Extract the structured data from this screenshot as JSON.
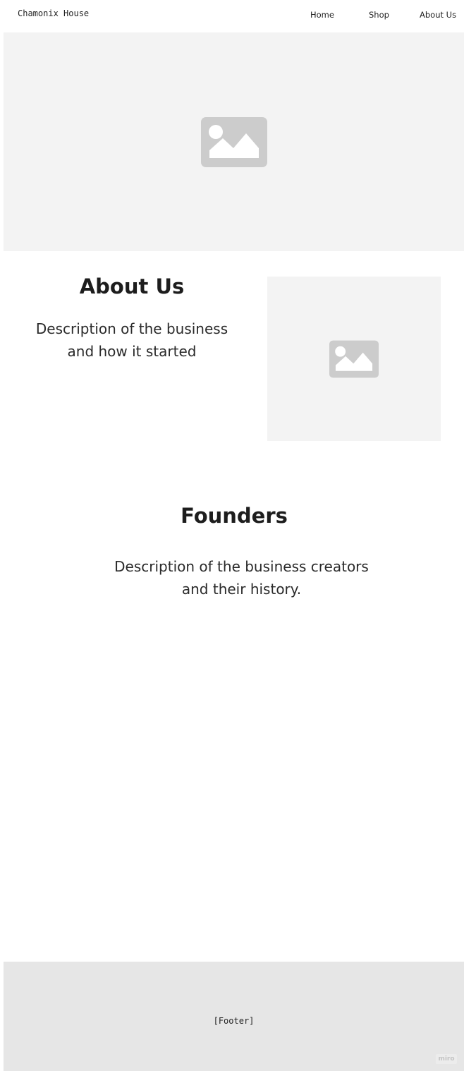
{
  "header": {
    "brand": "Chamonix House",
    "nav": {
      "home": "Home",
      "shop": "Shop",
      "about": "About Us"
    }
  },
  "hero": {
    "icon": "image-placeholder-icon"
  },
  "about": {
    "title": "About Us",
    "description_line1": "Description of the business",
    "description_line2": "and how it started",
    "icon": "image-placeholder-icon"
  },
  "founders": {
    "title": "Founders",
    "description_line1": "Description of the business creators",
    "description_line2": "and their history."
  },
  "footer": {
    "label": "[Footer]",
    "badge": "miro"
  },
  "colors": {
    "placeholder_bg": "#f3f3f3",
    "placeholder_icon": "#cccccc",
    "footer_bg": "#e6e6e6",
    "text": "#1d1d1d"
  }
}
